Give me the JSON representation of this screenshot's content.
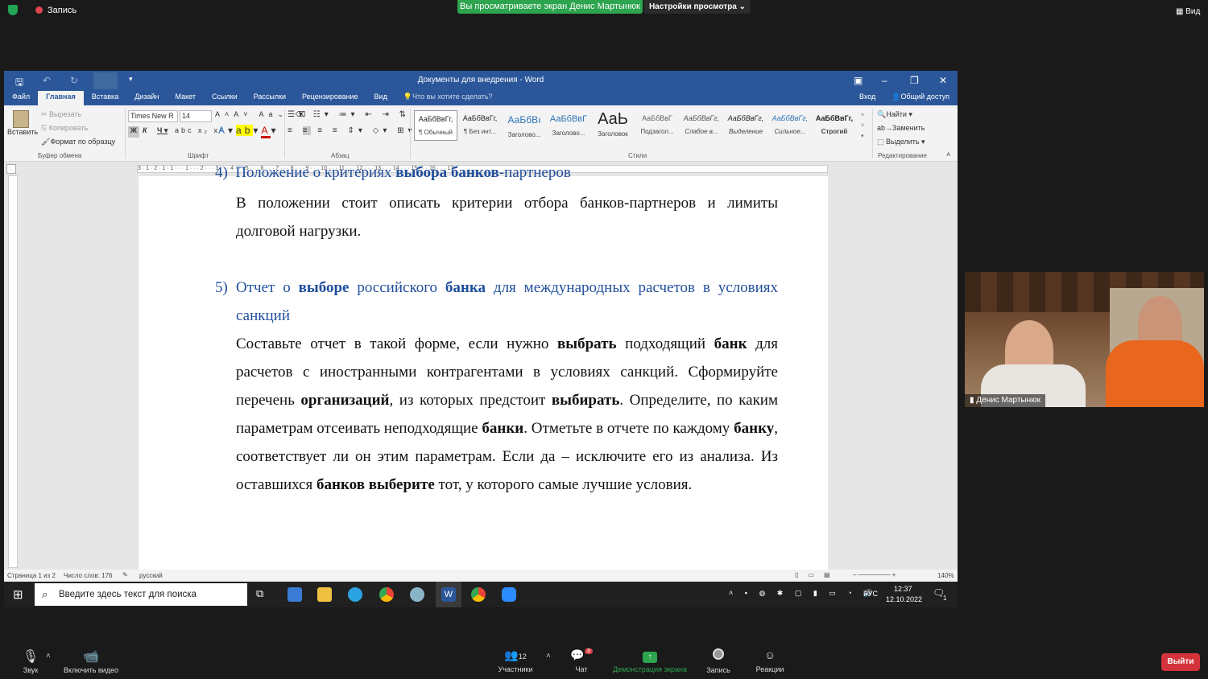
{
  "zoom": {
    "recording_label": "Запись",
    "share_banner": "Вы просматриваете экран Денис Мартынюк",
    "view_settings": "Настройки просмотра",
    "view_button": "Вид",
    "participant_name": "Денис Мартынюк",
    "bottom": {
      "audio": "Звук",
      "video": "Включить видео",
      "participants": "Участники",
      "participants_count": "12",
      "chat": "Чат",
      "chat_badge": "3",
      "share": "Демонстрация экрана",
      "record": "Запись",
      "reactions": "Реакции",
      "leave": "Выйти"
    }
  },
  "word": {
    "title": "Документы для внедрения - Word",
    "tabs": [
      "Файл",
      "Главная",
      "Вставка",
      "Дизайн",
      "Макет",
      "Ссылки",
      "Рассылки",
      "Рецензирование",
      "Вид"
    ],
    "tell_me": "Что вы хотите сделать?",
    "signin": "Вход",
    "share": "Общий доступ",
    "clipboard": {
      "paste": "Вставить",
      "cut": "Вырезать",
      "copy": "Копировать",
      "format_painter": "Формат по образцу",
      "label": "Буфер обмена"
    },
    "font": {
      "name": "Times New R",
      "size": "14",
      "label": "Шрифт"
    },
    "paragraph_label": "Абзац",
    "styles_label": "Стили",
    "styles": [
      {
        "preview": "АаБбВвГг,",
        "name": "¶ Обычный"
      },
      {
        "preview": "АаБбВвГг,",
        "name": "¶ Без инт..."
      },
      {
        "preview": "АаБбВı",
        "name": "Заголово..."
      },
      {
        "preview": "АаБбВвГ",
        "name": "Заголово..."
      },
      {
        "preview": "АаЬ",
        "name": "Заголовок"
      },
      {
        "preview": "АаБбВвГ",
        "name": "Подзагол..."
      },
      {
        "preview": "АаБбВвГг,",
        "name": "Слабое в..."
      },
      {
        "preview": "АаБбВвГг,",
        "name": "Выделение"
      },
      {
        "preview": "АаБбВвГг,",
        "name": "Сильное..."
      },
      {
        "preview": "АаБбВвГг,",
        "name": "Строгий"
      }
    ],
    "editing": {
      "find": "Найти",
      "replace": "Заменить",
      "select": "Выделить",
      "label": "Редактирование"
    },
    "ruler_numbers": "3 · 1 · 2 · 1 · 1 · · · 1 · · · 2 · · · 3 · · · 4 · · · 5 · · · 6 · · · 7 · · · 8 · · · 9 · · · 10 · · · 11 · · · 12 · · · 13 · · · 14 · · · 15 · · · 16 · · · 17",
    "doc": {
      "item4_num": "4)",
      "item4_a": "Положение о критериях ",
      "item4_b": "выбора банков",
      "item4_c": "-партнеров",
      "p1": "В положении стоит описать критерии отбора банков-партнеров и лимиты долговой нагрузки.",
      "item5_num": "5)",
      "item5_parts": [
        "Отчет о ",
        "выборе",
        " российского ",
        "банка",
        " для международных расчетов в условиях санкций"
      ],
      "p2_parts": [
        "Составьте отчет в такой форме, если нужно ",
        "выбрать",
        " подходящий ",
        "банк",
        " для расчетов с иностранными контрагентами в условиях санкций. Сформируйте перечень ",
        "организаций",
        ", из которых предстоит ",
        "выбирать",
        ". Определите, по каким параметрам отсеивать неподходящие ",
        "банки",
        ". Отметьте в отчете по каждому ",
        "банку",
        ", соответствует ли он этим параметрам. Если да – исключите его из анализа. Из оставшихся ",
        "банков выберите",
        " тот, у которого самые лучшие условия."
      ]
    },
    "status": {
      "page": "Страница 1 из 2",
      "words": "Число слов: 176",
      "lang": "русский",
      "zoom": "140%"
    },
    "taskbar": {
      "search": "Введите здесь текст для поиска",
      "lang": "РУС",
      "time": "12:37",
      "date": "12.10.2022",
      "notif": "1"
    }
  }
}
